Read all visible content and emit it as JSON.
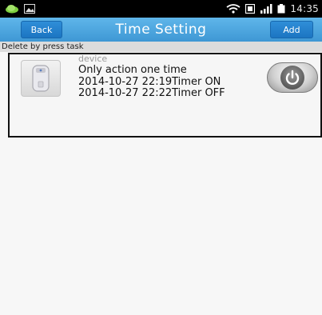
{
  "status_bar": {
    "time": "14:35",
    "icons": [
      "cloud-icon",
      "image-icon",
      "wifi-icon",
      "sim-icon",
      "signal-icon",
      "battery-icon"
    ]
  },
  "header": {
    "title": "Time Setting",
    "back_label": "Back",
    "add_label": "Add"
  },
  "hint": "Delete by press task",
  "tasks": [
    {
      "device_name": "device",
      "mode": "Only action one time",
      "timer_on": "2014-10-27 22:19Timer ON",
      "timer_off": "2014-10-27 22:22Timer OFF",
      "icons": [
        "smart-plug-icon",
        "power-icon"
      ]
    }
  ],
  "colors": {
    "header_bg": "#4aa6e0",
    "button_bg": "#2a86d0",
    "hint_bg": "#dcdcdc",
    "content_bg": "#f7f7f7"
  }
}
